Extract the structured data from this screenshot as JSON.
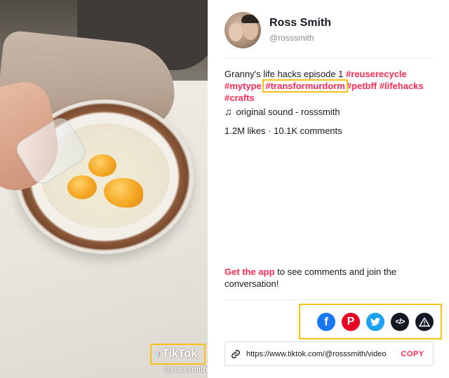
{
  "video": {
    "watermark_brand": "TikTok",
    "watermark_handle": "@rosssmith"
  },
  "author": {
    "name": "Ross Smith",
    "handle": "@rosssmith"
  },
  "description": {
    "text": "Granny's life hacks episode 1",
    "hashtags": [
      "#reuserecycle",
      "#mytype",
      "#transformurdorm",
      "#petbff",
      "#lifehacks",
      "#crafts"
    ]
  },
  "sound": {
    "label": "original sound - rosssmith"
  },
  "stats": {
    "likes": "1.2M likes",
    "separator": " · ",
    "comments": "10.1K comments"
  },
  "cta": {
    "link_text": "Get the app",
    "rest_text": " to see comments and join the conversation!"
  },
  "share": {
    "icons": [
      "facebook-icon",
      "pinterest-icon",
      "twitter-icon",
      "embed-icon",
      "report-icon"
    ]
  },
  "link": {
    "url": "https://www.tiktok.com/@rosssmith/video",
    "copy_label": "COPY"
  },
  "colors": {
    "accent": "#fe2c55",
    "highlight_box": "#f4c21a",
    "facebook": "#1877f2",
    "pinterest": "#e60023",
    "twitter": "#1da1f2"
  }
}
